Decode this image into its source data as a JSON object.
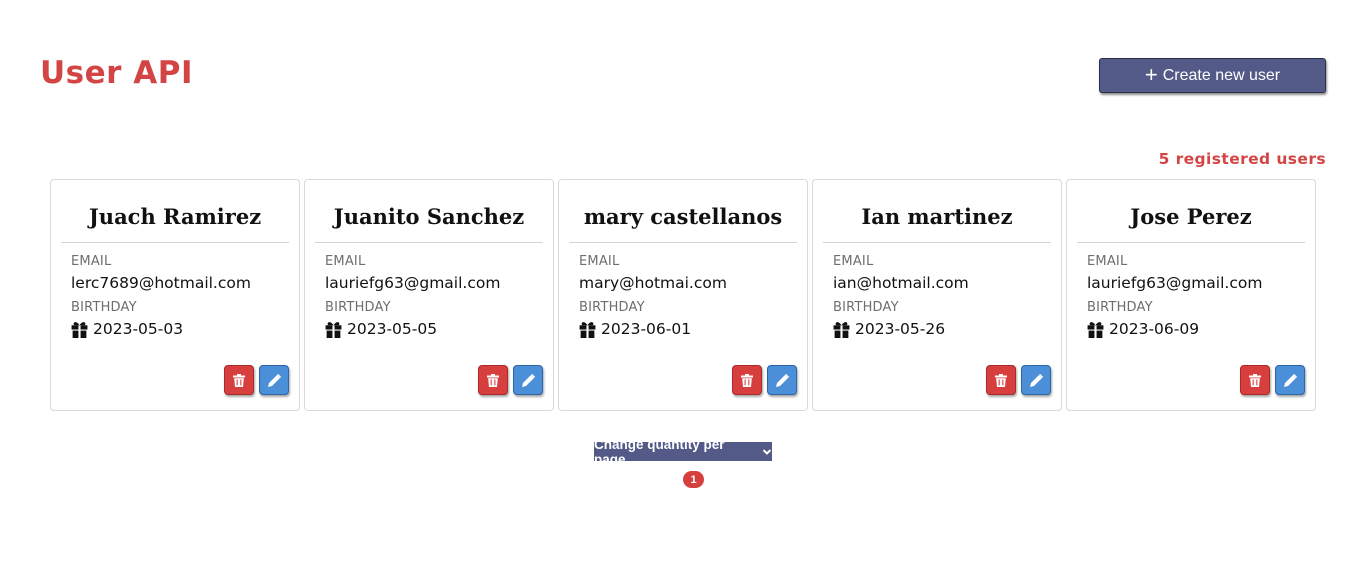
{
  "header": {
    "title": "User API",
    "create_label": "Create new user"
  },
  "summary": {
    "count_text": "5 registered users"
  },
  "labels": {
    "email": "EMAIL",
    "birthday": "BIRTHDAY"
  },
  "users": [
    {
      "name": "Juach Ramirez",
      "email": "lerc7689@hotmail.com",
      "birthday": "2023-05-03"
    },
    {
      "name": "Juanito Sanchez",
      "email": "lauriefg63@gmail.com",
      "birthday": "2023-05-05"
    },
    {
      "name": "mary castellanos",
      "email": "mary@hotmai.com",
      "birthday": "2023-06-01"
    },
    {
      "name": "Ian martinez",
      "email": "ian@hotmail.com",
      "birthday": "2023-05-26"
    },
    {
      "name": "Jose Perez",
      "email": "lauriefg63@gmail.com",
      "birthday": "2023-06-09"
    }
  ],
  "pagination": {
    "per_page_label": "Change quantity per page",
    "current_page": "1"
  },
  "colors": {
    "accent_red": "#d34545",
    "primary_indigo": "#535a87",
    "delete_red": "#d73f3f",
    "edit_blue": "#4a8fd8"
  },
  "icons": {
    "create": "plus-icon",
    "birthday": "gift-icon",
    "delete": "trash-icon",
    "edit": "pencil-icon",
    "dropdown": "chevron-down-icon"
  }
}
